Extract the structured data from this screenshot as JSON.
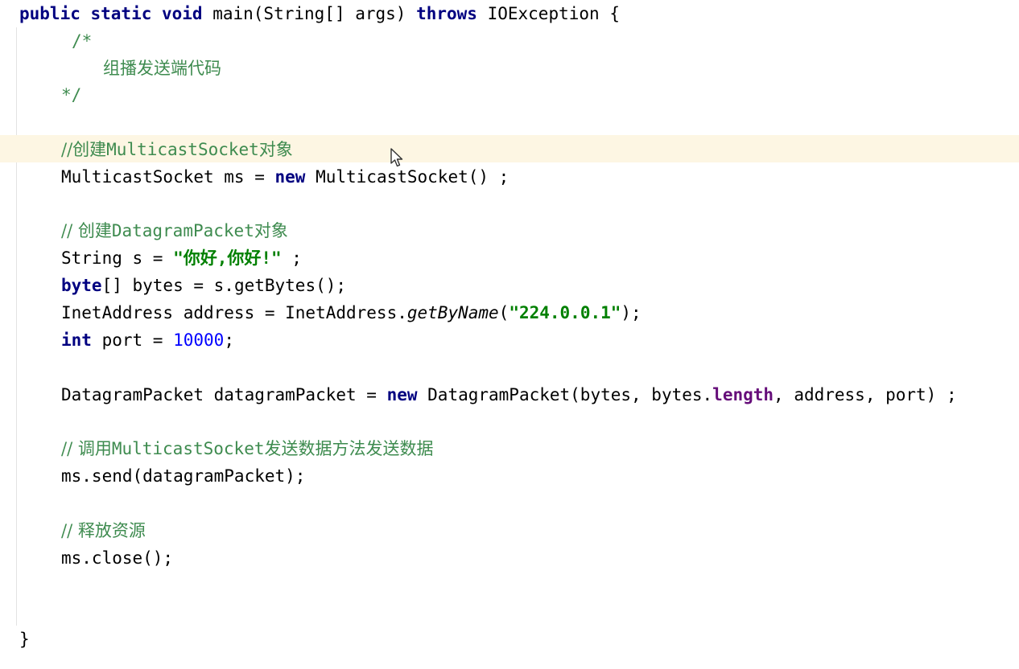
{
  "code": {
    "l1_kw": "public static void",
    "l1_mid": " main(String[] args) ",
    "l1_kw2": "throws",
    "l1_end": " IOException {",
    "l2": "/*",
    "l3": "组播发送端代码",
    "l4": "*/",
    "l5_a": "//创建",
    "l5_b": "MulticastSocket",
    "l5_c": "对象",
    "l6_a": "MulticastSocket ms = ",
    "l6_kw": "new",
    "l6_b": " MulticastSocket() ;",
    "l7_a": "// 创建",
    "l7_b": "DatagramPacket",
    "l7_c": "对象",
    "l8_a": "String s = ",
    "l8_str": "\"你好,你好!\"",
    "l8_b": " ;",
    "l9_kw": "byte",
    "l9_b": "[] bytes = s.getBytes();",
    "l10_a": "InetAddress address = InetAddress.",
    "l10_call": "getByName",
    "l10_b": "(",
    "l10_str": "\"224.0.0.1\"",
    "l10_c": ");",
    "l11_kw": "int",
    "l11_a": " port = ",
    "l11_num": "10000",
    "l11_b": ";",
    "l12_a": "DatagramPacket datagramPacket = ",
    "l12_kw": "new",
    "l12_b": " DatagramPacket(bytes, bytes.",
    "l12_field": "length",
    "l12_c": ", address, port) ;",
    "l13_a": "// 调用",
    "l13_b": "MulticastSocket",
    "l13_c": "发送数据方法发送数据",
    "l14": "ms.send(datagramPacket);",
    "l15_a": "// 释放资源",
    "l16": "ms.close();",
    "l17": "}"
  },
  "colors": {
    "keyword": "#000080",
    "comment": "#3e8b4f",
    "string": "#008000",
    "number": "#0000ff",
    "field": "#660e7a",
    "caret_row": "#fdf6e3"
  },
  "icons": {
    "mouse_cursor": "arrow-cursor-icon"
  }
}
